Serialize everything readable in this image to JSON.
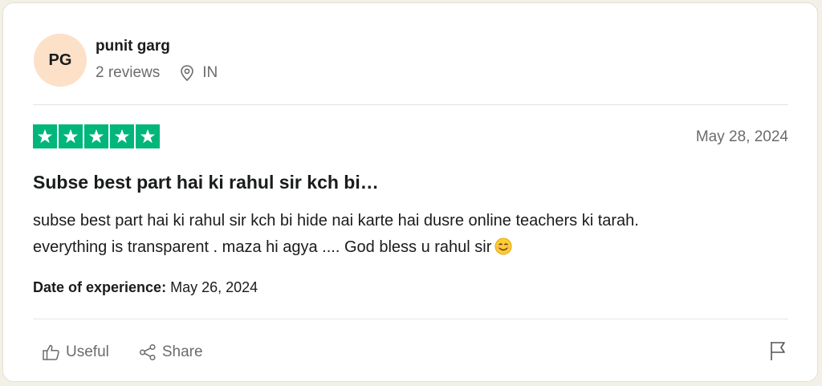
{
  "reviewer": {
    "initials": "PG",
    "name": "punit garg",
    "reviews_count": "2 reviews",
    "location": "IN",
    "avatar_color": "#fde0c8"
  },
  "rating": {
    "stars": 5,
    "max_stars": 5,
    "star_color": "#00b67a"
  },
  "review": {
    "date": "May 28, 2024",
    "title": "Subse best part hai ki rahul sir kch bi…",
    "body_line1": "subse best part hai ki rahul sir kch bi hide nai karte hai dusre online teachers ki tarah.",
    "body_line2": "everything is transparent . maza hi agya .... God bless u rahul sir",
    "emoji": "smiling-face-emoji",
    "experience_label": "Date of experience:",
    "experience_date": "May 26, 2024"
  },
  "actions": {
    "useful_label": "Useful",
    "share_label": "Share",
    "useful_icon": "thumbs-up-icon",
    "share_icon": "share-icon",
    "flag_icon": "flag-icon"
  }
}
